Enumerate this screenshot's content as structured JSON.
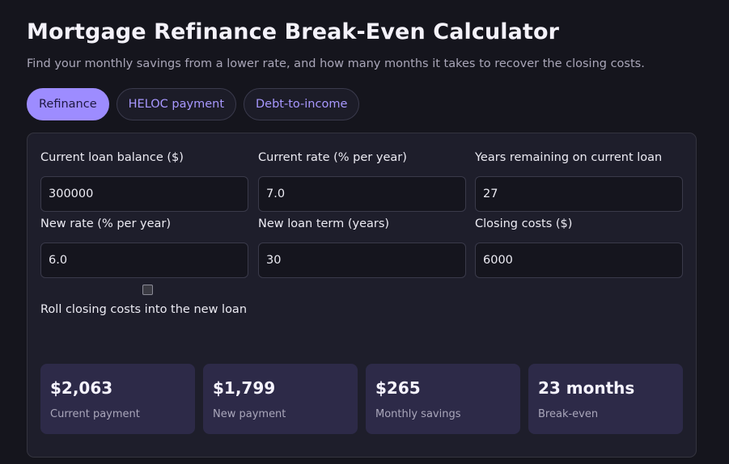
{
  "header": {
    "title": "Mortgage Refinance Break-Even Calculator",
    "subtitle": "Find your monthly savings from a lower rate, and how many months it takes to recover the closing costs."
  },
  "tabs": [
    {
      "label": "Refinance",
      "active": true
    },
    {
      "label": "HELOC payment",
      "active": false
    },
    {
      "label": "Debt-to-income",
      "active": false
    }
  ],
  "form": {
    "current_balance": {
      "label": "Current loan balance ($)",
      "value": "300000"
    },
    "current_rate": {
      "label": "Current rate (% per year)",
      "value": "7.0"
    },
    "years_remaining": {
      "label": "Years remaining on current loan",
      "value": "27"
    },
    "new_rate": {
      "label": "New rate (% per year)",
      "value": "6.0"
    },
    "new_term": {
      "label": "New loan term (years)",
      "value": "30"
    },
    "closing_costs": {
      "label": "Closing costs ($)",
      "value": "6000"
    },
    "roll_costs": {
      "label": "Roll closing costs into the new loan",
      "checked": false
    }
  },
  "results": [
    {
      "value": "$2,063",
      "label": "Current payment"
    },
    {
      "value": "$1,799",
      "label": "New payment"
    },
    {
      "value": "$265",
      "label": "Monthly savings"
    },
    {
      "value": "23 months",
      "label": "Break-even"
    }
  ],
  "colors": {
    "accent": "#9d8cff",
    "background": "#15151d",
    "panel": "#1e1e2b",
    "card": "#2d2a48"
  }
}
